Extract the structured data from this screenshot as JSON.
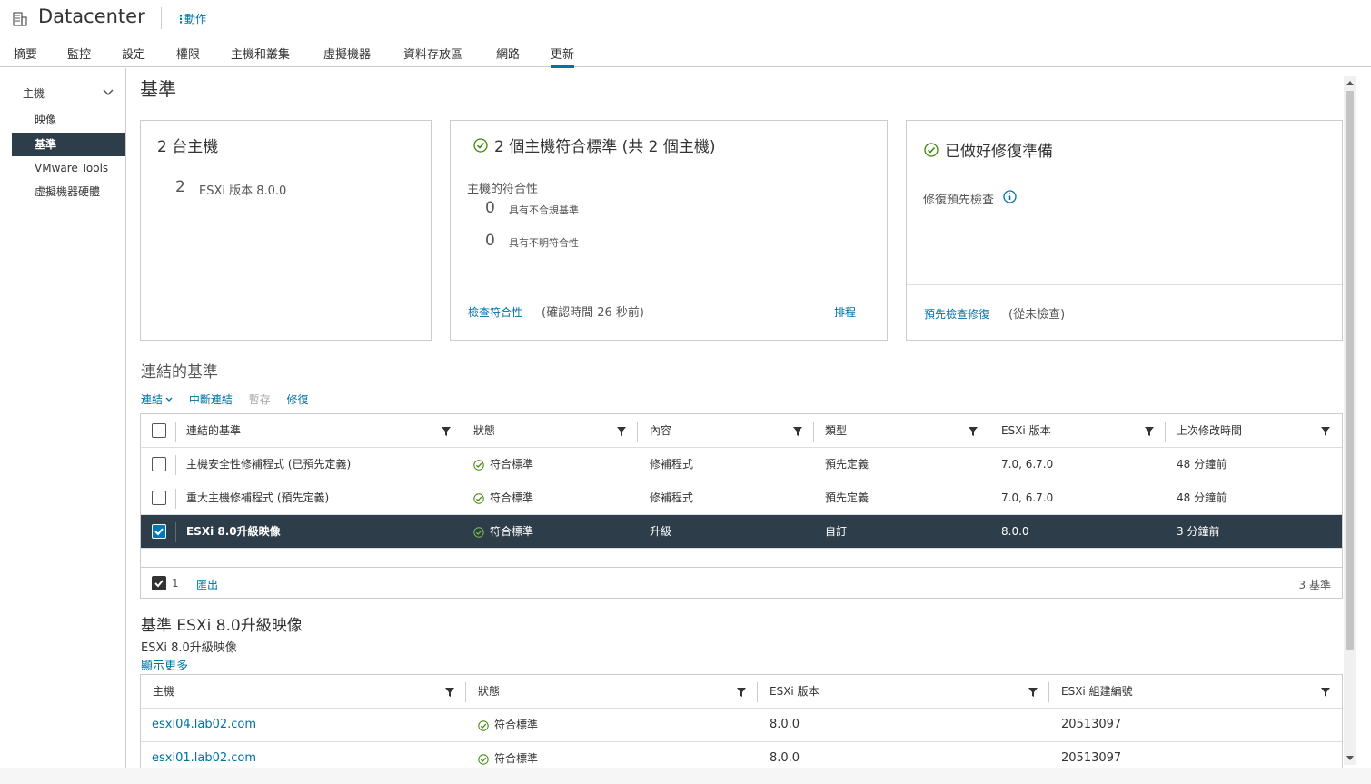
{
  "header": {
    "title": "Datacenter",
    "actions_label": "動作"
  },
  "tabs": [
    {
      "label": "摘要"
    },
    {
      "label": "監控"
    },
    {
      "label": "設定"
    },
    {
      "label": "權限"
    },
    {
      "label": "主機和叢集"
    },
    {
      "label": "虛擬機器"
    },
    {
      "label": "資料存放區"
    },
    {
      "label": "網路"
    },
    {
      "label": "更新"
    }
  ],
  "active_tab": "更新",
  "sidebar": {
    "group": "主機",
    "items": [
      {
        "label": "映像"
      },
      {
        "label": "基準"
      },
      {
        "label": "VMware Tools"
      },
      {
        "label": "虛擬機器硬體"
      }
    ],
    "active_item": "基準"
  },
  "page": {
    "heading": "基準"
  },
  "cards": {
    "hosts": {
      "title": "2 台主機",
      "count": "2",
      "version_label": "ESXi 版本 8.0.0"
    },
    "compliance": {
      "title": "2 個主機符合標準 (共 2 個主機)",
      "subtitle": "主機的符合性",
      "noncompliant_count": "0",
      "noncompliant_label": "具有不合規基準",
      "unknown_count": "0",
      "unknown_label": "具有不明符合性",
      "check_link": "檢查符合性",
      "check_note": "(確認時間 26 秒前)",
      "schedule_link": "排程"
    },
    "remediation": {
      "title": "已做好修復準備",
      "precheck_label": "修復預先檢查",
      "precheck_link": "預先檢查修復",
      "precheck_note": "(從未檢查)"
    }
  },
  "attached": {
    "title": "連結的基準",
    "toolbar": {
      "attach": "連結",
      "detach": "中斷連結",
      "stage": "暫存",
      "remediate": "修復"
    },
    "columns": [
      "連結的基準",
      "狀態",
      "內容",
      "類型",
      "ESXi 版本",
      "上次修改時間"
    ],
    "rows": [
      {
        "name": "主機安全性修補程式 (已預先定義)",
        "status": "符合標準",
        "content": "修補程式",
        "type": "預先定義",
        "version": "7.0, 6.7.0",
        "modified": "48 分鐘前",
        "selected": false
      },
      {
        "name": "重大主機修補程式 (預先定義)",
        "status": "符合標準",
        "content": "修補程式",
        "type": "預先定義",
        "version": "7.0, 6.7.0",
        "modified": "48 分鐘前",
        "selected": false
      },
      {
        "name": "ESXi 8.0升級映像",
        "status": "符合標準",
        "content": "升級",
        "type": "自訂",
        "version": "8.0.0",
        "modified": "3 分鐘前",
        "selected": true
      }
    ],
    "footer": {
      "selected_count": "1",
      "export_link": "匯出",
      "total": "3 基準"
    }
  },
  "detail": {
    "title": "基準 ESXi 8.0升級映像",
    "subtitle": "ESXi 8.0升級映像",
    "show_more": "顯示更多",
    "columns": [
      "主機",
      "狀態",
      "ESXi 版本",
      "ESXi 組建編號"
    ],
    "rows": [
      {
        "host": "esxi04.lab02.com",
        "status": "符合標準",
        "version": "8.0.0",
        "build": "20513097"
      },
      {
        "host": "esxi01.lab02.com",
        "status": "符合標準",
        "version": "8.0.0",
        "build": "20513097"
      }
    ]
  },
  "colors": {
    "accent": "#0072a3",
    "selected_row": "#2d3e4a",
    "ok_green": "#3c8500"
  }
}
